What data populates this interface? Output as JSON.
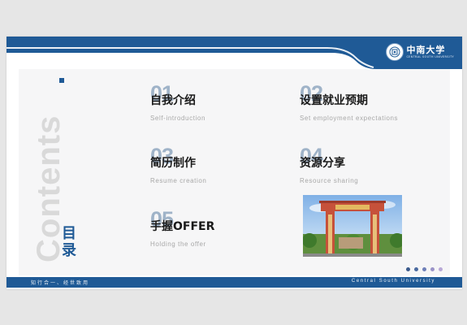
{
  "header": {
    "logo_title": "中南大学",
    "logo_subtitle": "CENTRAL SOUTH UNIVERSITY",
    "brand_color": "#1f5a96"
  },
  "sidebar": {
    "watermark": "Contents.",
    "heading_line1": "目",
    "heading_line2": "录"
  },
  "items": [
    {
      "num": "01",
      "title": "自我介绍",
      "subtitle": "Self-introduction"
    },
    {
      "num": "02",
      "title": "设置就业预期",
      "subtitle": "Set employment expectations"
    },
    {
      "num": "03",
      "title": "简历制作",
      "subtitle": "Resume creation"
    },
    {
      "num": "04",
      "title": "资源分享",
      "subtitle": "Resource sharing"
    },
    {
      "num": "05",
      "title": "手握OFFER",
      "subtitle": "Holding the offer"
    }
  ],
  "photo": {
    "icon": "university-gate-photo"
  },
  "pager": {
    "dot_colors": [
      "#3b5a8c",
      "#4a6aa0",
      "#6e7fb8",
      "#9a93c8",
      "#b8a8d6"
    ]
  },
  "footer": {
    "left_text": "知行合一、经世致用",
    "right_text": "Central South University"
  }
}
